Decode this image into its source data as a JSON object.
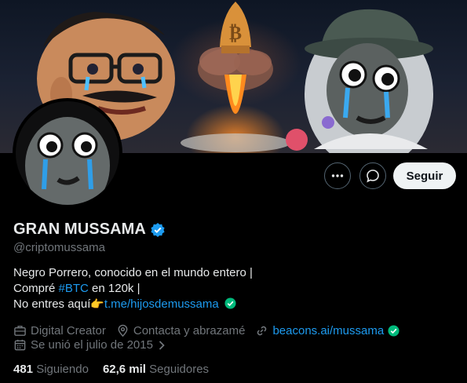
{
  "profile": {
    "display_name": "GRAN MUSSAMA",
    "handle": "@criptomussama",
    "verified": true,
    "bio": {
      "line1": "Negro Porrero, conocido en el mundo entero |",
      "line2_pre": "Compré ",
      "line2_hashtag": "#BTC",
      "line2_post": " en 120k  |",
      "line3_pre": "No entres aquí",
      "line3_emoji": "👉",
      "line3_link": "t.me/hijosdemussama"
    },
    "category": "Digital Creator",
    "location": "Contacta y abrazamé",
    "website": "beacons.ai/mussama",
    "joined": "Se unió el julio de 2015"
  },
  "stats": {
    "following_count": "481",
    "following_label": "Siguiendo",
    "followers_count": "62,6 mil",
    "followers_label": "Seguidores"
  },
  "actions": {
    "follow_label": "Seguir"
  },
  "colors": {
    "accent": "#1d9bf0",
    "verified_badge": "#1d9bf0",
    "link_check": "#00ba7c",
    "secondary_text": "#71767b",
    "follow_button_bg": "#eff3f4"
  },
  "icons": {
    "more": "more-dots-icon",
    "message": "chat-bubble-icon",
    "verified": "verified-badge-icon",
    "category": "briefcase-icon",
    "location": "location-pin-icon",
    "website": "link-icon",
    "joined": "calendar-icon",
    "joined_expand": "chevron-right-icon",
    "link_verified": "check-circle-icon"
  }
}
